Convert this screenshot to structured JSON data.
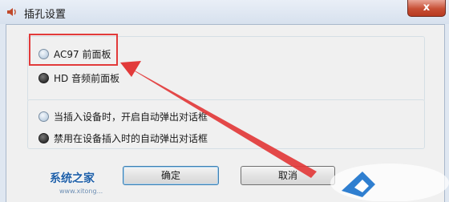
{
  "window": {
    "title": "插孔设置",
    "close_glyph": "x"
  },
  "panel_options": [
    {
      "label": "AC97 前面板",
      "selected": false
    },
    {
      "label": "HD 音频前面板",
      "selected": true
    }
  ],
  "dialog_options": [
    {
      "label": "当插入设备时，开启自动弹出对话框",
      "selected": false
    },
    {
      "label": "禁用在设备插入时的自动弹出对话框",
      "selected": true
    }
  ],
  "buttons": {
    "ok": "确定",
    "cancel": "取消"
  },
  "annotation": {
    "color": "#e23a3a"
  },
  "watermark": {
    "text": "系统之家",
    "url": "www.xitong..."
  }
}
